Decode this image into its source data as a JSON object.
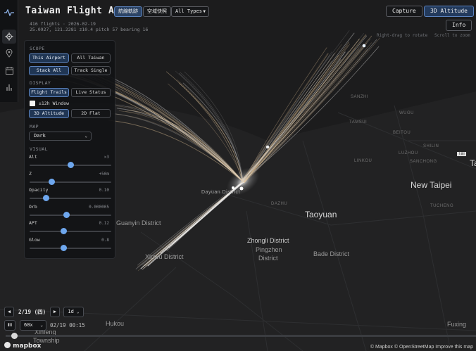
{
  "header": {
    "title": "Taiwan Flight Arc",
    "tab_arc": "航線軌跡",
    "tab_airspace": "空域快照",
    "type_select": "All Types",
    "info_line1": "416 flights · 2026-02-19",
    "info_line2": "25.0927, 121.2281 z10.4 pitch 57 bearing 16"
  },
  "toolbar_right": {
    "capture": "Capture",
    "altitude_3d": "3D Altitude",
    "info": "Info",
    "hint_rotate": "Right-drag to rotate",
    "hint_zoom": "Scroll to zoom"
  },
  "rail": {
    "icons": [
      "pulse-icon",
      "gear-icon",
      "location-pin-icon",
      "calendar-icon",
      "bar-chart-icon"
    ]
  },
  "panel": {
    "scope": {
      "title": "SCOPE",
      "this_airport": "This Airport",
      "all_taiwan": "All Taiwan",
      "stack_all": "Stack All",
      "track_single": "Track Single"
    },
    "display": {
      "title": "DISPLAY",
      "flight_trails": "Flight Trails",
      "live_status": "Live Status",
      "window_label": "±12h Window",
      "altitude_3d": "3D Altitude",
      "flat_2d": "2D Flat"
    },
    "map": {
      "title": "MAP",
      "style": "Dark"
    },
    "visual": {
      "title": "VISUAL",
      "sliders": [
        {
          "label": "Alt",
          "value": "×3",
          "level": 0.5
        },
        {
          "label": "Z",
          "value": "+50m",
          "level": 0.27
        },
        {
          "label": "Opacity",
          "value": "0.10",
          "level": 0.2
        },
        {
          "label": "Orb",
          "value": "0.000005",
          "level": 0.45
        },
        {
          "label": "APT",
          "value": "0.12",
          "level": 0.41
        },
        {
          "label": "Glow",
          "value": "0.8",
          "level": 0.41
        }
      ]
    }
  },
  "playback": {
    "prev": "◀",
    "date": "2/19 (四)",
    "next": "▶",
    "range": "1d",
    "pause": "❚❚",
    "speed": "60x",
    "time": "02/19 00:15"
  },
  "map_labels": {
    "new_taipei": "New Taipei",
    "taoyuan": "Taoyuan",
    "zhongli": "Zhongli District",
    "pingzhen1": "Pingzhen",
    "pingzhen2": "District",
    "bade": "Bade District",
    "guanyin": "Guanyin District",
    "xinwu": "Xinwu District",
    "dayuan": "Dayuan District",
    "dazhu": "DAZHU",
    "hukou": "Hukou",
    "xinfeng1": "Xinfeng",
    "xinfeng2": "Township",
    "fuxing": "Fuxing",
    "sanchong": "SANCHONG",
    "luzhou": "LUZHOU",
    "shilin": "SHILIN",
    "beitou": "BEITOU",
    "tamsui": "TAMSUI",
    "sanzhi": "SANZHI",
    "wugu": "WUGU",
    "linkou": "LINKOU",
    "tucheng": "TUCHENG",
    "tai": "Tai",
    "taipei_edge": "Ta"
  },
  "branding": {
    "logo": "mapbox",
    "attribution": "© Mapbox © OpenStreetMap  Improve this map"
  }
}
